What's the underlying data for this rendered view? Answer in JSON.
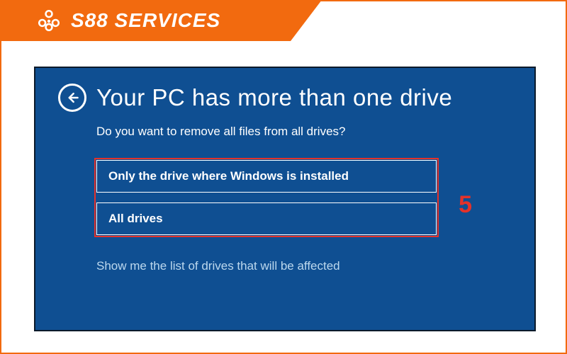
{
  "brand": {
    "name": "S88 SERVICES",
    "accent_color": "#f26a0f"
  },
  "screen": {
    "background_color": "#0f4f92",
    "title": "Your PC has more than one drive",
    "subtitle": "Do you want to remove all files from all drives?",
    "options": [
      {
        "label": "Only the drive where Windows is installed"
      },
      {
        "label": "All drives"
      }
    ],
    "affected_link": "Show me the list of drives that will be affected",
    "annotation": {
      "step_number": "5",
      "highlight_color": "#e4322a"
    }
  }
}
